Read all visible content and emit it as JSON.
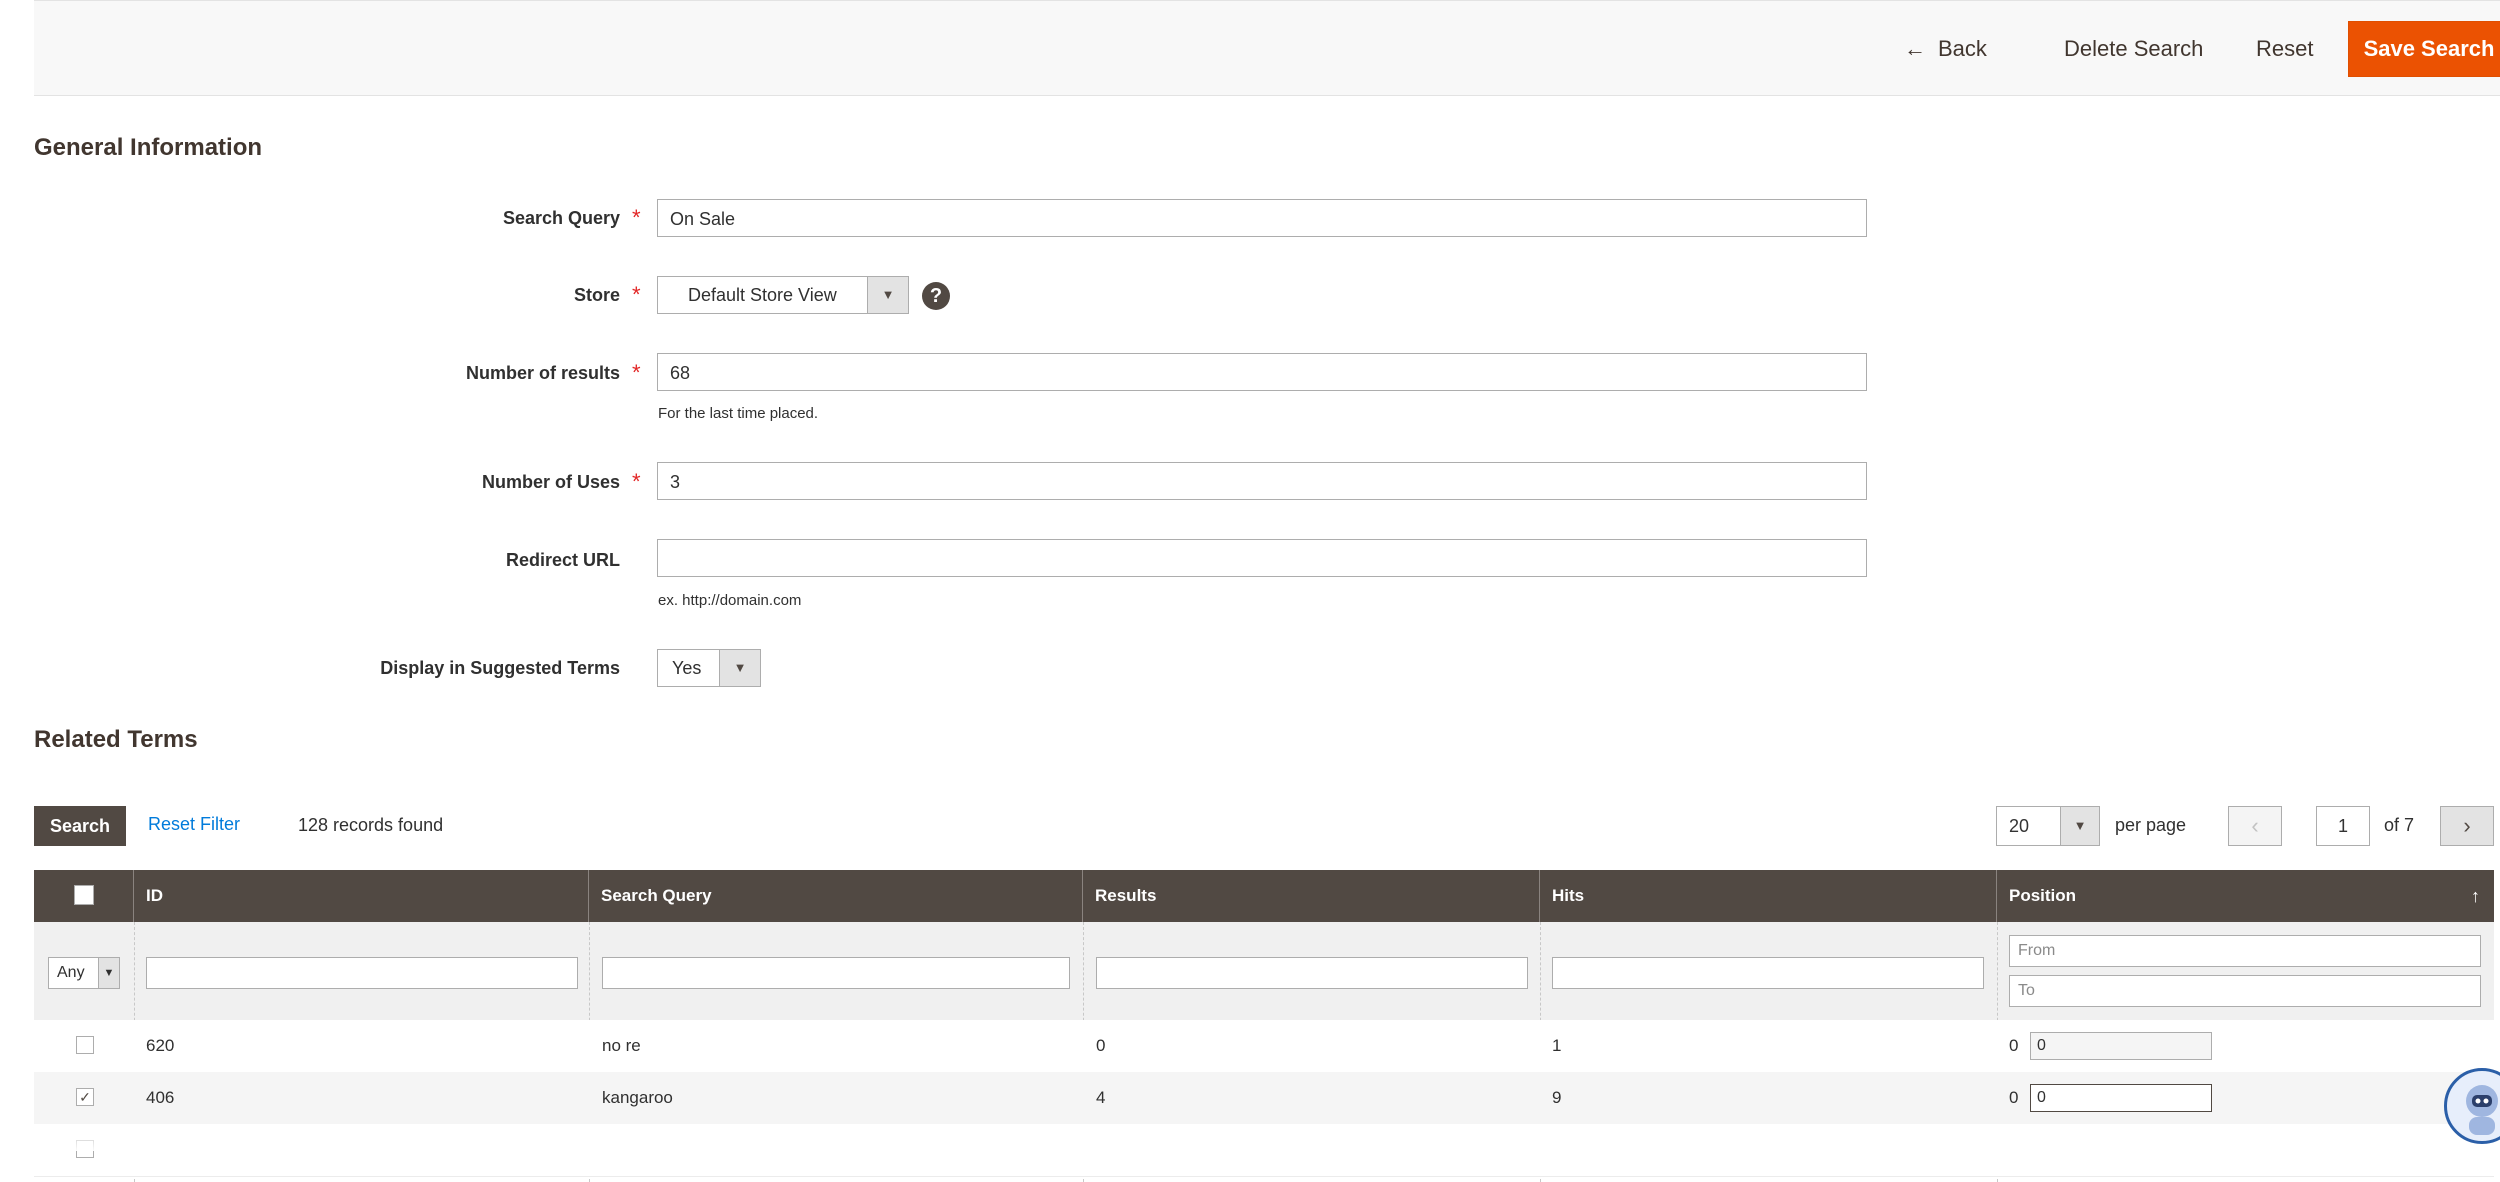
{
  "header": {
    "back_label": "Back",
    "delete_label": "Delete Search",
    "reset_label": "Reset",
    "save_label": "Save Search"
  },
  "general": {
    "title": "General Information",
    "search_query": {
      "label": "Search Query",
      "value": "On Sale"
    },
    "store": {
      "label": "Store",
      "value": "Default Store View"
    },
    "num_results": {
      "label": "Number of results",
      "value": "68",
      "note": "For the last time placed."
    },
    "num_uses": {
      "label": "Number of Uses",
      "value": "3"
    },
    "redirect_url": {
      "label": "Redirect URL",
      "value": "",
      "note": "ex. http://domain.com"
    },
    "suggested": {
      "label": "Display in Suggested Terms",
      "value": "Yes"
    }
  },
  "related": {
    "title": "Related Terms",
    "search_label": "Search",
    "reset_filter_label": "Reset Filter",
    "records_found": "128 records found",
    "per_page_value": "20",
    "per_page_label": "per page",
    "current_page": "1",
    "of_pages": "of 7",
    "columns": [
      "ID",
      "Search Query",
      "Results",
      "Hits",
      "Position"
    ],
    "filter_any": "Any",
    "position_from_placeholder": "From",
    "position_to_placeholder": "To",
    "rows": [
      {
        "checked": false,
        "id": "620",
        "query": "no re",
        "results": "0",
        "hits": "1",
        "pos_text": "0",
        "pos_value": "0"
      },
      {
        "checked": true,
        "id": "406",
        "query": "kangaroo",
        "results": "4",
        "hits": "9",
        "pos_text": "0",
        "pos_value": "0"
      }
    ]
  }
}
